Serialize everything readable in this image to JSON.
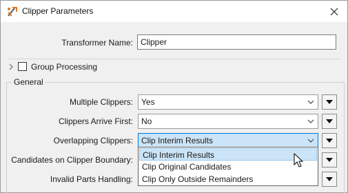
{
  "window": {
    "title": "Clipper Parameters"
  },
  "transformer": {
    "name_label": "Transformer Name:",
    "name_value": "Clipper"
  },
  "group_processing": {
    "label": "Group Processing",
    "checked": false
  },
  "general": {
    "title": "General",
    "multiple_clippers": {
      "label": "Multiple Clippers:",
      "value": "Yes"
    },
    "clippers_arrive_first": {
      "label": "Clippers Arrive First:",
      "value": "No"
    },
    "overlapping_clippers": {
      "label": "Overlapping Clippers:",
      "value": "Clip Interim Results",
      "options": [
        "Clip Interim Results",
        "Clip Original Candidates",
        "Clip Only Outside Remainders"
      ]
    },
    "candidates_on_boundary": {
      "label": "Candidates on Clipper Boundary:"
    },
    "invalid_parts_handling": {
      "label": "Invalid Parts Handling:"
    }
  },
  "colors": {
    "selection": "#cce4f7",
    "focus_border": "#0078d7",
    "background": "#f0f0f0"
  }
}
